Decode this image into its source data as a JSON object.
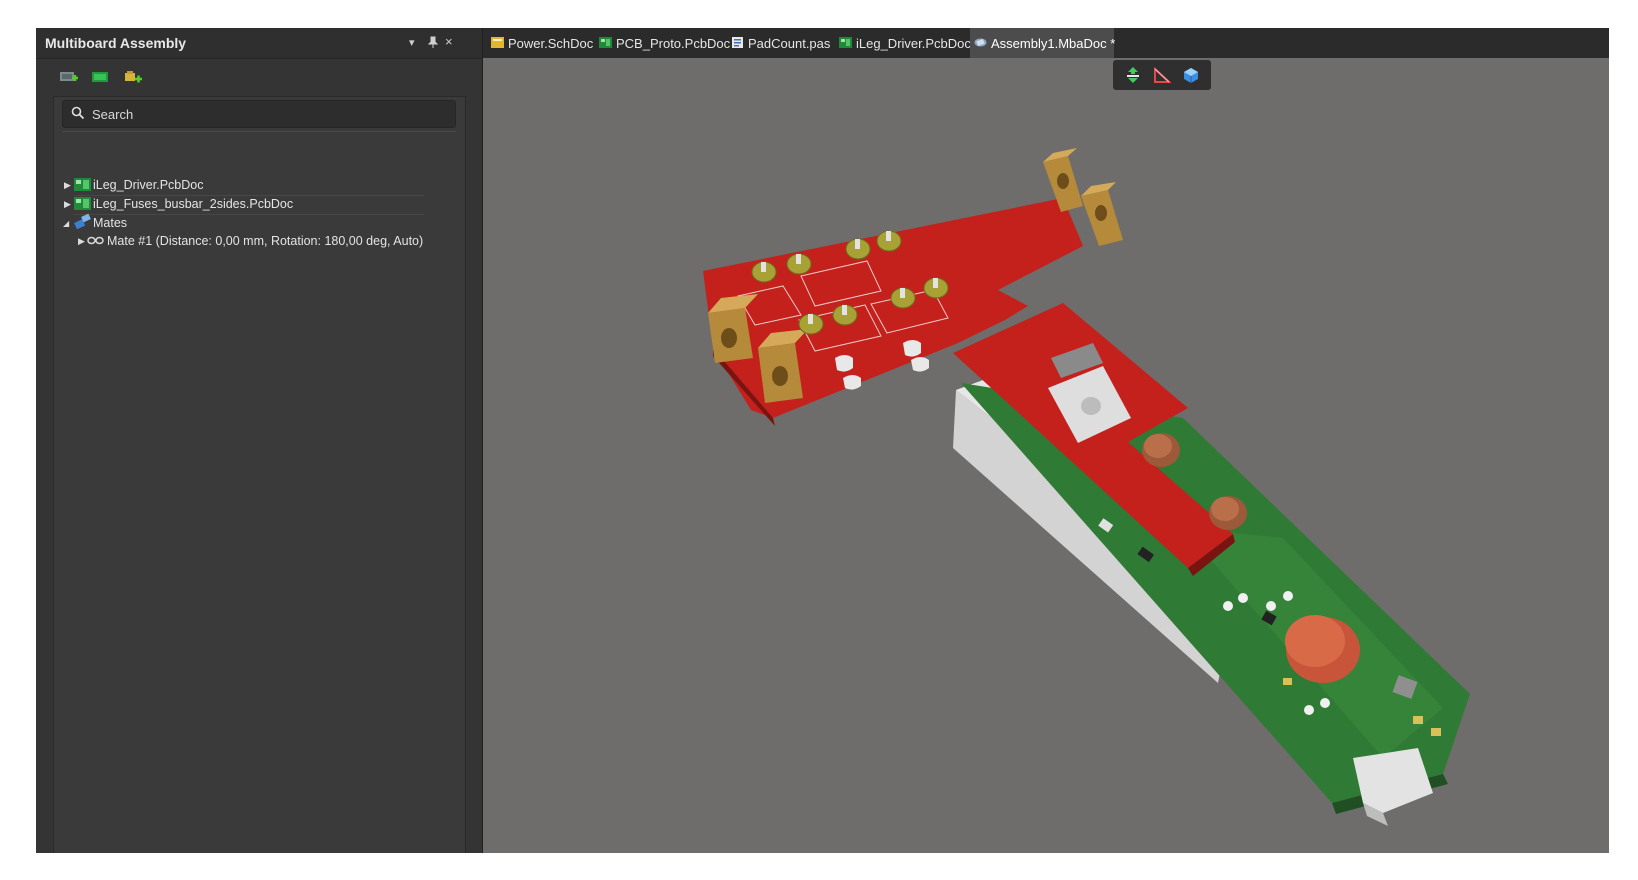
{
  "panel": {
    "title": "Multiboard Assembly",
    "controls": {
      "dropdown": "▾",
      "pin": "📌",
      "close": "×"
    },
    "search_placeholder": "Search",
    "tree": [
      {
        "label": "iLeg_Driver.PcbDoc",
        "icon": "pcb-doc-icon",
        "expanded": false
      },
      {
        "label": "iLeg_Fuses_busbar_2sides.PcbDoc",
        "icon": "pcb-doc-icon",
        "expanded": false
      },
      {
        "label": "Mates",
        "icon": "mates-icon",
        "expanded": true
      },
      {
        "label": "Mate #1 (Distance: 0,00 mm, Rotation: 180,00 deg, Auto)",
        "icon": "mate-link-icon",
        "expanded": false
      }
    ],
    "toolbar_icons": [
      "insert-child-project-icon",
      "insert-design-icon",
      "insert-part-icon"
    ]
  },
  "tabs": [
    {
      "label": "Power.SchDoc",
      "icon": "schematic-doc-icon",
      "active": false
    },
    {
      "label": "PCB_Proto.PcbDoc",
      "icon": "pcb-doc-icon",
      "active": false
    },
    {
      "label": "PadCount.pas",
      "icon": "script-doc-icon",
      "active": false
    },
    {
      "label": "iLeg_Driver.PcbDoc",
      "icon": "pcb-doc-icon",
      "active": false
    },
    {
      "label": "Assembly1.MbaDoc *",
      "icon": "assembly-doc-icon",
      "active": true
    }
  ],
  "view_toolbar": [
    "align-view-icon",
    "section-view-icon",
    "view-cube-icon"
  ],
  "colors": {
    "viewport_bg": "#6e6d6c",
    "busbar_board": "#c4211c",
    "driver_board": "#2f7a34",
    "terminal_brass": "#b58a3a",
    "accent_tab": "#4c4c4c"
  }
}
